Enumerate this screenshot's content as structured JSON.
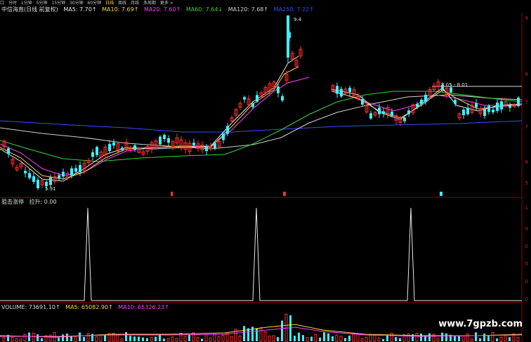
{
  "toolbar": {
    "items": [
      "口",
      "分时",
      "1分钟",
      "5分钟",
      "15分钟",
      "30分钟",
      "60分钟",
      "日线",
      "周线",
      "月线",
      "多周期",
      "更多 >"
    ],
    "selected": 7
  },
  "kline_header": {
    "stock": "中信海直(日线 前复权)",
    "indicators": [
      {
        "label": "MA5: 7.70↑",
        "color": "#e8e8e8"
      },
      {
        "label": "MA10: 7.69↑",
        "color": "#ffd34a"
      },
      {
        "label": "MA20: 7.60↑",
        "color": "#ff40ff"
      },
      {
        "label": "MA60: 7.64↓",
        "color": "#38d438"
      },
      {
        "label": "MA120: 7.68↑",
        "color": "#d0d0d0"
      },
      {
        "label": "MA250: 7.22↑",
        "color": "#3b4cff"
      }
    ],
    "high_label": "9.4",
    "range_label": "8.05 - 8.01",
    "low_label": "5.91"
  },
  "signal_header": {
    "title": "狙击涨停",
    "indicators": [
      {
        "label": "拉升: 0.00",
        "color": "#e8e8e8"
      }
    ]
  },
  "volume_header": {
    "title": "VOLUME: 73691.10↑",
    "indicators": [
      {
        "label": "MA5: 65082.90↑",
        "color": "#ffd34a"
      },
      {
        "label": "MA10: 65326.23↑",
        "color": "#ff40ff"
      }
    ]
  },
  "price_axis": [
    "9",
    "8",
    "7",
    "7",
    "6",
    "5"
  ],
  "signal_axis": [
    "1",
    "0",
    "0",
    "0",
    "0",
    "0"
  ],
  "watermark": "www.7gpzb.com",
  "colors": {
    "up": "#ff3030",
    "down": "#3ef0ff",
    "axis": "#8b0000"
  }
}
